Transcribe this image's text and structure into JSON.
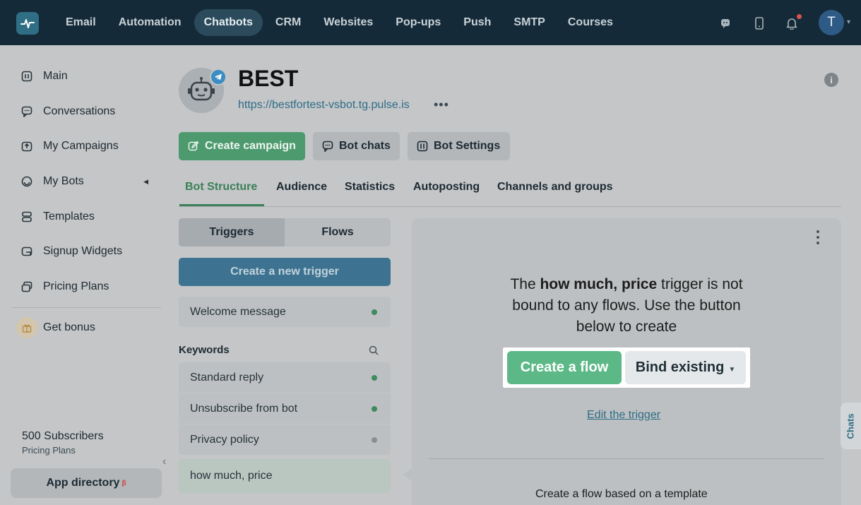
{
  "topnav": {
    "tabs": [
      "Email",
      "Automation",
      "Chatbots",
      "CRM",
      "Websites",
      "Pop-ups",
      "Push",
      "SMTP",
      "Courses"
    ],
    "active_tab": "Chatbots",
    "avatar_letter": "T"
  },
  "sidebar": {
    "items": [
      {
        "label": "Main",
        "icon": "dashboard-icon"
      },
      {
        "label": "Conversations",
        "icon": "chat-icon"
      },
      {
        "label": "My Campaigns",
        "icon": "campaign-icon"
      },
      {
        "label": "My Bots",
        "icon": "bot-icon"
      },
      {
        "label": "Templates",
        "icon": "templates-icon"
      },
      {
        "label": "Signup Widgets",
        "icon": "widget-icon"
      },
      {
        "label": "Pricing Plans",
        "icon": "pricing-icon"
      }
    ],
    "bonus_label": "Get bonus",
    "subscribers": "500 Subscribers",
    "subscribers_sub": "Pricing Plans",
    "app_directory": "App directory",
    "beta": "β"
  },
  "bot": {
    "name": "BEST",
    "url": "https://bestfortest-vsbot.tg.pulse.is",
    "more": "•••"
  },
  "actions": {
    "create_campaign": "Create campaign",
    "bot_chats": "Bot chats",
    "bot_settings": "Bot Settings"
  },
  "tabs": [
    "Bot Structure",
    "Audience",
    "Statistics",
    "Autoposting",
    "Channels and groups"
  ],
  "segment": {
    "triggers": "Triggers",
    "flows": "Flows"
  },
  "new_trigger": "Create a new trigger",
  "welcome": "Welcome message",
  "keywords_label": "Keywords",
  "keyword_items": [
    "Standard reply",
    "Unsubscribe from bot",
    "Privacy policy",
    "how much, price"
  ],
  "panel": {
    "msg_pre": "The ",
    "msg_bold": "how much, price",
    "msg_post": " trigger is not bound to any flows. Use the button below to create",
    "create_flow": "Create a flow",
    "bind_existing": "Bind existing",
    "edit_trigger": "Edit the trigger",
    "template_text": "Create a flow based on a template"
  },
  "chats_tab": "Chats",
  "colors": {
    "accent_green": "#4c9a6e",
    "nav_bg": "#152a38",
    "link_blue": "#2e6d86"
  }
}
